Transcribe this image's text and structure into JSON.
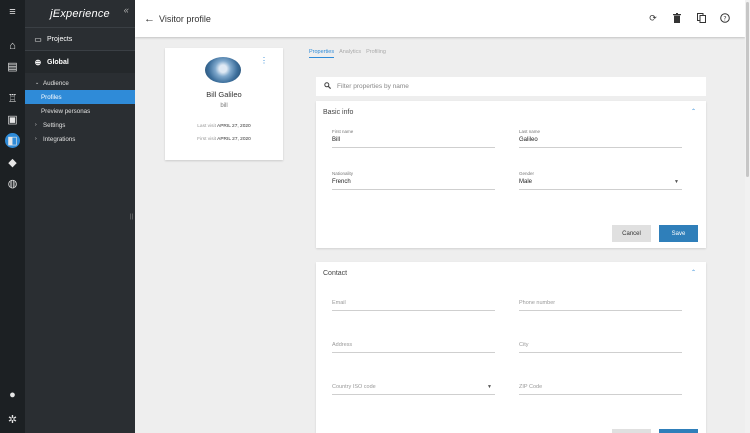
{
  "rail": {
    "icons": [
      "hamburger-icon",
      "home-icon",
      "clipboard-icon",
      "bank-icon",
      "image-icon",
      "profile-card-icon",
      "tag-icon",
      "compass-icon",
      "account-icon",
      "gear-icon"
    ],
    "glyphs": [
      "≡",
      "⌂",
      "▤",
      "♖",
      "▣",
      "◧",
      "◆",
      "◍",
      "●",
      "✲"
    ]
  },
  "nav": {
    "brand": "jExperience",
    "collapse": "«",
    "projects": "Projects",
    "global": "Global",
    "audience": "Audience",
    "profiles": "Profiles",
    "preview_personas": "Preview personas",
    "settings": "Settings",
    "integrations": "Integrations",
    "resize": "||"
  },
  "topbar": {
    "back": "←",
    "title": "Visitor profile"
  },
  "profile": {
    "name": "Bill Galileo",
    "username": "bill",
    "last_visit_label": "Last visit",
    "last_visit": "APRIL 27, 2020",
    "first_visit_label": "First visit",
    "first_visit": "APRIL 27, 2020"
  },
  "tabs": {
    "properties": "Properties",
    "analytics": "Analytics",
    "profiling": "Profiling"
  },
  "filter": {
    "placeholder": "Filter properties by name",
    "icon": "search-icon"
  },
  "basic": {
    "title": "Basic info",
    "first_name_label": "First name",
    "first_name": "Bill",
    "last_name_label": "Last name",
    "last_name": "Galileo",
    "nationality_label": "Nationality",
    "nationality": "French",
    "gender_label": "Gender",
    "gender": "Male",
    "cancel": "Cancel",
    "save": "Save"
  },
  "contact": {
    "title": "Contact",
    "email": "Email",
    "phone": "Phone number",
    "address": "Address",
    "city": "City",
    "country": "Country ISO code",
    "zip": "ZIP Code"
  },
  "colors": {
    "accent": "#2f8bd8",
    "sidebar": "#2a2e32",
    "rail": "#1c2023",
    "save": "#2f7fba"
  }
}
